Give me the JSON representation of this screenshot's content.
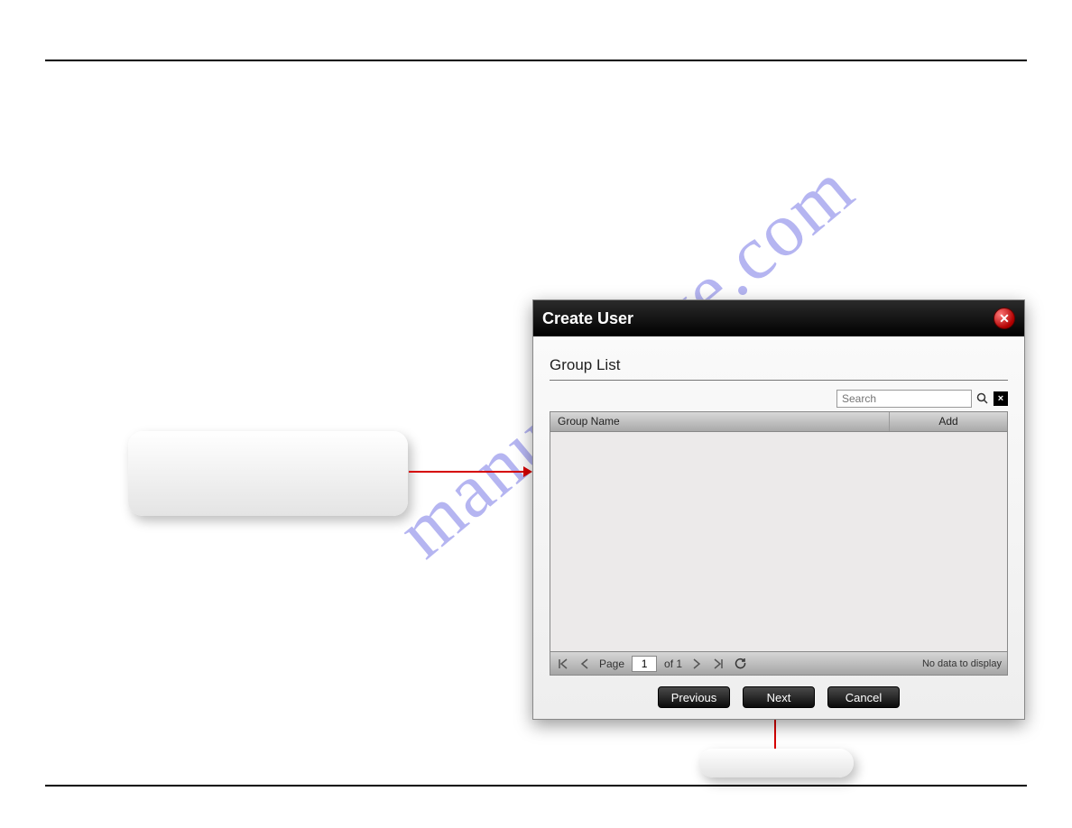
{
  "watermark": "manualshive.com",
  "dialog": {
    "title": "Create User",
    "section_title": "Group List",
    "search_placeholder": "Search",
    "columns": {
      "name": "Group Name",
      "add": "Add"
    },
    "pager": {
      "page_label": "Page",
      "page_value": "1",
      "of_label": "of 1",
      "no_data": "No data to display"
    },
    "buttons": {
      "previous": "Previous",
      "next": "Next",
      "cancel": "Cancel"
    }
  }
}
